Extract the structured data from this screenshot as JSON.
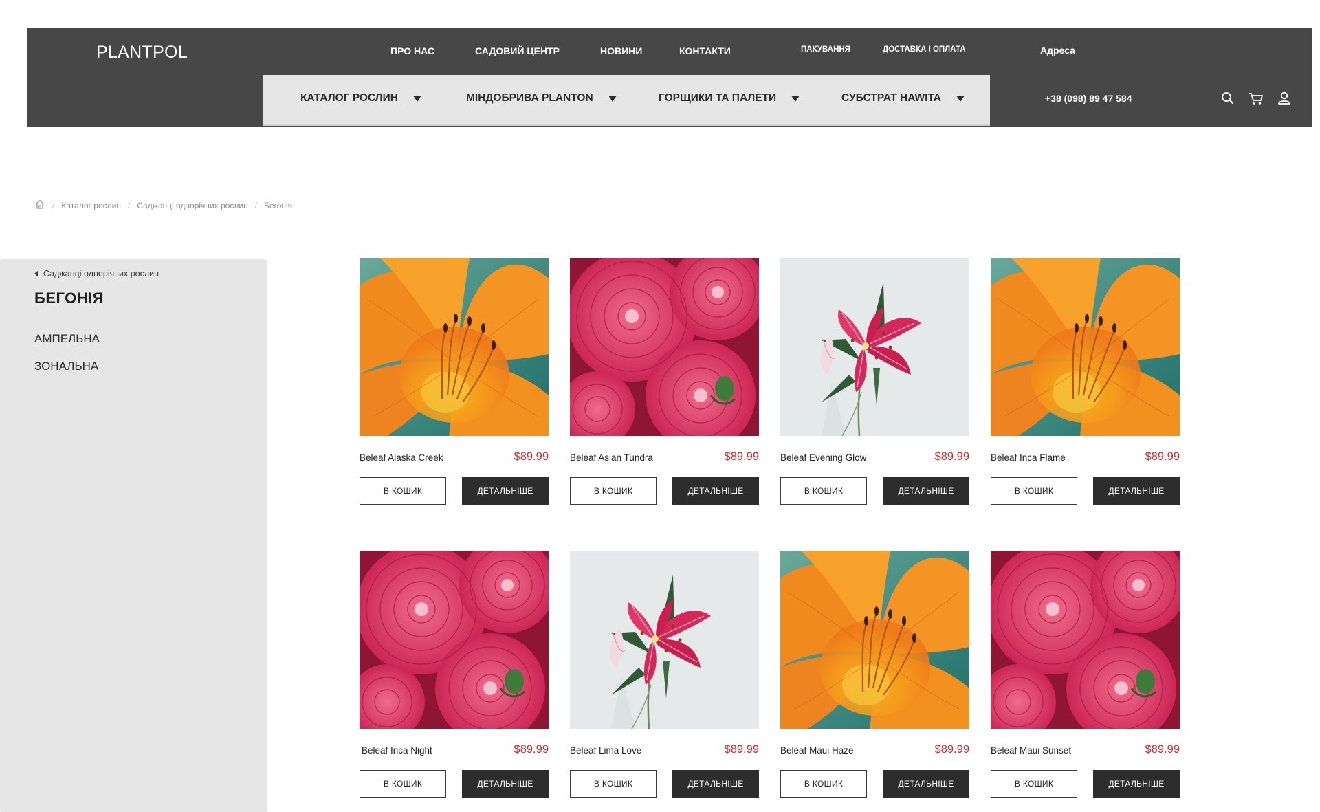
{
  "header": {
    "logo": "PLANTPOL",
    "top_nav": [
      "ПРО НАС",
      "САДОВИЙ ЦЕНТР",
      "НОВИНИ",
      "КОНТАКТИ"
    ],
    "small_nav": [
      "ПАКУВАННЯ",
      "ДОСТАВКА І ОПЛАТА"
    ],
    "address_label": "Адреса",
    "phone": "+38 (098) 89 47 584",
    "categories": [
      "КАТАЛОГ РОСЛИН",
      "МІНДОБРИВА PLANTON",
      "ГОРЩИКИ ТА ПАЛЕТИ",
      "СУБСТРАТ HAWITA"
    ],
    "icons": [
      "search-icon",
      "cart-icon",
      "user-icon"
    ]
  },
  "breadcrumb": {
    "home_icon": "home-icon",
    "items": [
      "Каталог рослин",
      "Саджанці однорічних рослин",
      "Бегонія"
    ]
  },
  "sidebar": {
    "back_label": "Саджанці однорічних рослин",
    "title": "БЕГОНІЯ",
    "items": [
      "АМПЕЛЬНА",
      "ЗОНАЛЬНА"
    ]
  },
  "buttons": {
    "cart_label": "В КОШИК",
    "details_label": "ДЕТАЛЬНІШЕ"
  },
  "products": [
    {
      "name": "Beleaf Alaska Creek",
      "price": "$89.99",
      "image": "orange-lily"
    },
    {
      "name": "Beleaf Asian Tundra",
      "price": "$89.99",
      "image": "pink-dahlia"
    },
    {
      "name": "Beleaf Evening Glow",
      "price": "$89.99",
      "image": "stargazer-lily"
    },
    {
      "name": "Beleaf Inca Flame",
      "price": "$89.99",
      "image": "orange-lily"
    },
    {
      "name": "Beleaf Inca Night",
      "price": "$89.99",
      "image": "pink-dahlia"
    },
    {
      "name": "Beleaf Lima Love",
      "price": "$89.99",
      "image": "stargazer-lily"
    },
    {
      "name": "Beleaf Maui Haze",
      "price": "$89.99",
      "image": "orange-lily"
    },
    {
      "name": "Beleaf Maui Sunset",
      "price": "$89.99",
      "image": "pink-dahlia"
    }
  ],
  "colors": {
    "header_bg": "#474747",
    "category_bar_bg": "#e6e6e6",
    "sidebar_bg": "#e6e6e6",
    "price": "#d62b2b",
    "details_button_bg": "#2d2d2d"
  }
}
